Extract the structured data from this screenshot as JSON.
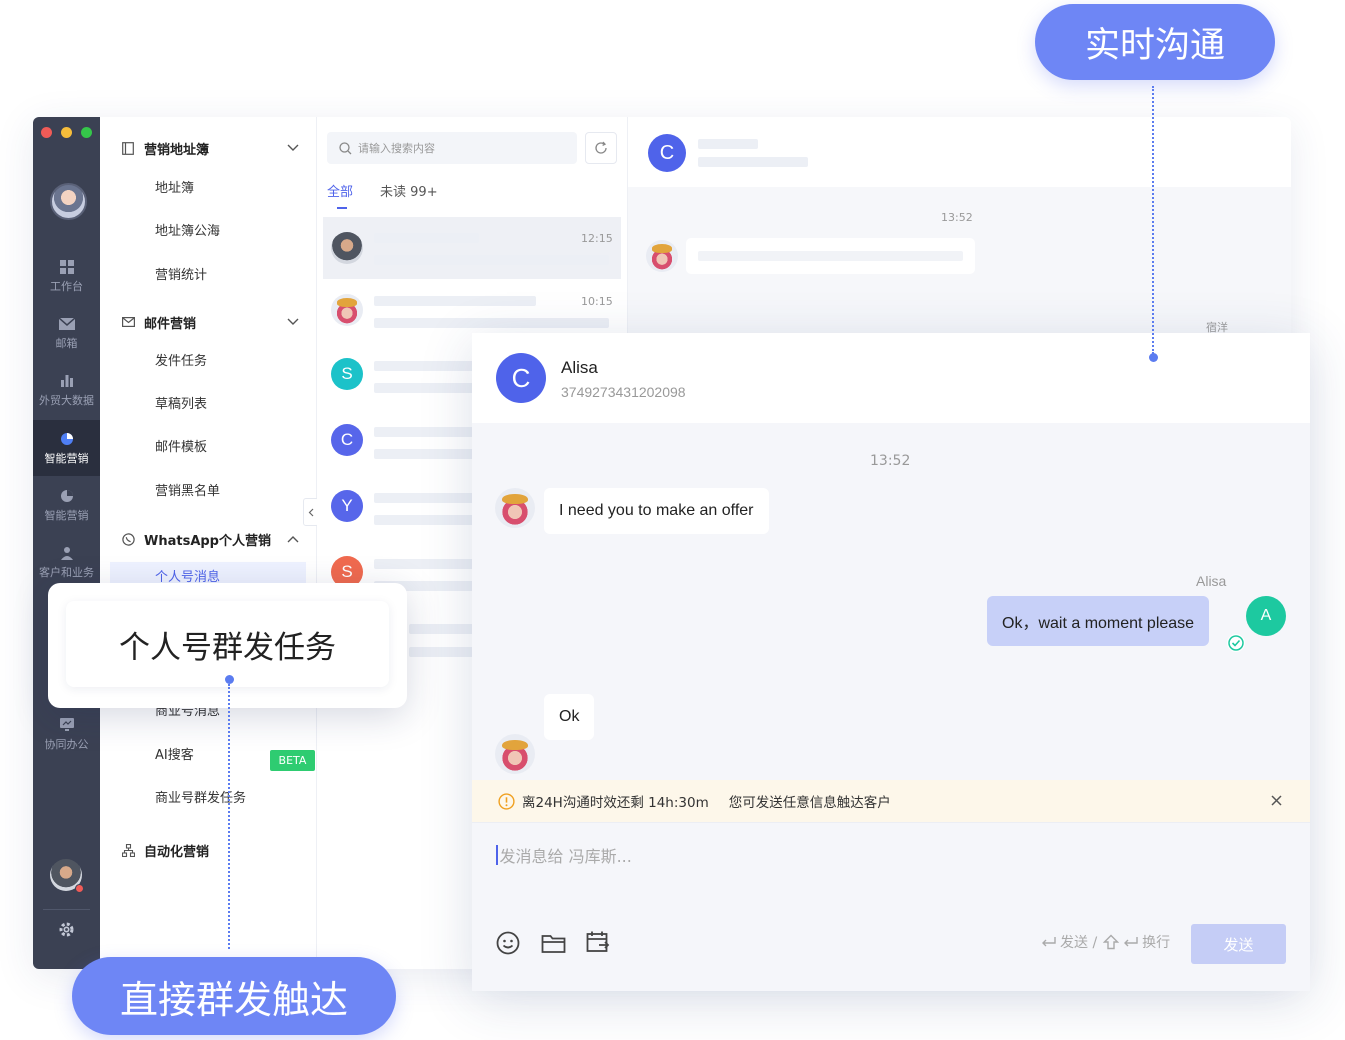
{
  "callouts": {
    "top": "实时沟通",
    "popup": "个人号群发任务",
    "bottom": "直接群发触达"
  },
  "rail": {
    "items": [
      {
        "label": "工作台",
        "icon": "grid-icon"
      },
      {
        "label": "邮箱",
        "icon": "mail-icon"
      },
      {
        "label": "外贸大数据",
        "icon": "bar-chart-icon"
      },
      {
        "label": "智能营销",
        "icon": "pie-chart-icon"
      },
      {
        "label": "智能营销",
        "icon": "pie-chart-icon"
      },
      {
        "label": "客户和业务",
        "icon": "user-icon"
      },
      {
        "label": "协同办公",
        "icon": "monitor-icon"
      }
    ]
  },
  "menu": {
    "group1": "营销地址簿",
    "group1_items": [
      "地址簿",
      "地址簿公海",
      "营销统计"
    ],
    "group2": "邮件营销",
    "group2_items": [
      "发件任务",
      "草稿列表",
      "邮件模板",
      "营销黑名单"
    ],
    "group3": "WhatsApp个人营销",
    "group3_active": "个人号消息",
    "group3_items": [
      "商业号消息",
      "AI搜客",
      "商业号群发任务"
    ],
    "beta": "BETA",
    "group4": "自动化营销"
  },
  "convlist": {
    "search_placeholder": "请输入搜索内容",
    "tab_all": "全部",
    "tab_unread": "未读",
    "unread_count": "99+",
    "rows": [
      {
        "time": "12:15"
      },
      {
        "time": "10:15"
      },
      {
        "letter": "S",
        "color": "#1cc2c9"
      },
      {
        "letter": "C",
        "color": "#5766ea"
      },
      {
        "letter": "Y",
        "color": "#5766ea"
      },
      {
        "letter": "S",
        "color": "#f06a4f"
      }
    ]
  },
  "bgchat": {
    "avatar_letter": "C",
    "time": "13:52",
    "sender": "宿洋"
  },
  "chat": {
    "avatar_letter": "C",
    "name": "Alisa",
    "phone": "3749273431202098",
    "time": "13:52",
    "msg1": "I need you to make an offer",
    "my_name": "Alisa",
    "my_avatar": "A",
    "msg2": "Ok，wait a moment please",
    "msg3": "Ok",
    "notice_timer": "离24H沟通时效还剩 14h:30m",
    "notice_text": "您可发送任意信息触达客户",
    "input_placeholder": "发消息给 冯库斯...",
    "hint_send": "发送 /",
    "hint_newline": "换行",
    "send_label": "发送"
  },
  "colors": {
    "accent": "#6e86f5",
    "brand_blue": "#4f63ea",
    "green": "#1dc9a0",
    "rail_bg": "#3b4153"
  }
}
